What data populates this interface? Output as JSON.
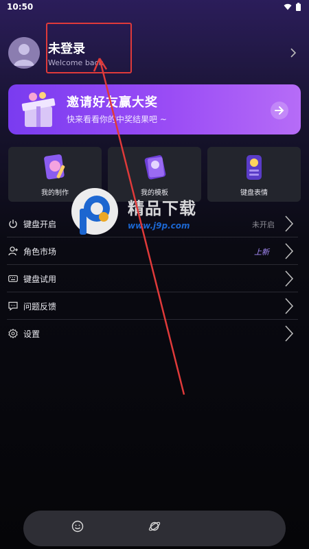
{
  "status_bar": {
    "time": "10:50",
    "icons": [
      "wifi-icon",
      "battery-icon"
    ]
  },
  "profile": {
    "title": "未登录",
    "subtitle": "Welcome back"
  },
  "invite_banner": {
    "title": "邀请好友赢大奖",
    "subtitle": "快来看看你的中奖结果吧 ~"
  },
  "cards": [
    {
      "label": "我的制作",
      "icon": "my-creations-icon"
    },
    {
      "label": "我的模板",
      "icon": "my-templates-icon"
    },
    {
      "label": "键盘表情",
      "icon": "keyboard-emoji-icon"
    }
  ],
  "menu": [
    {
      "label": "键盘开启",
      "icon": "power-icon",
      "status": "未开启"
    },
    {
      "label": "角色市场",
      "icon": "person-plus-icon",
      "badge": "上新"
    },
    {
      "label": "键盘试用",
      "icon": "keyboard-icon"
    },
    {
      "label": "问题反馈",
      "icon": "chat-icon"
    },
    {
      "label": "设置",
      "icon": "gear-icon"
    }
  ],
  "tab_bar": {
    "items": [
      "smile-icon",
      "planet-icon"
    ]
  },
  "watermark": {
    "text": "精品下载",
    "url": "www.j9p.com"
  },
  "colors": {
    "accent": "#8b45f3",
    "annotation": "#e03a3a"
  }
}
